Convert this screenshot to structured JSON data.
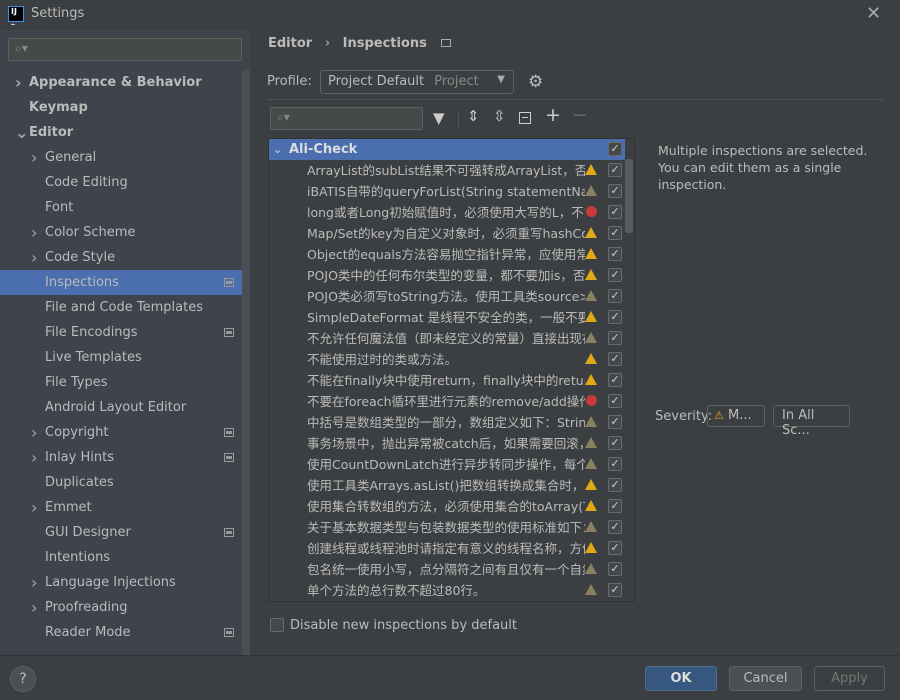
{
  "window": {
    "title": "Settings",
    "logo": "IJ"
  },
  "sidebar": {
    "search_placeholder": "",
    "items": [
      {
        "label": "Appearance & Behavior",
        "bold": true,
        "arrow": ">",
        "level": 0
      },
      {
        "label": "Keymap",
        "bold": true,
        "level": 0
      },
      {
        "label": "Editor",
        "bold": true,
        "arrow": "v",
        "level": 0
      },
      {
        "label": "General",
        "arrow": ">",
        "level": 1
      },
      {
        "label": "Code Editing",
        "level": 1
      },
      {
        "label": "Font",
        "level": 1
      },
      {
        "label": "Color Scheme",
        "arrow": ">",
        "level": 1
      },
      {
        "label": "Code Style",
        "arrow": ">",
        "level": 1
      },
      {
        "label": "Inspections",
        "level": 1,
        "selected": true,
        "project_icon": true
      },
      {
        "label": "File and Code Templates",
        "level": 1
      },
      {
        "label": "File Encodings",
        "level": 1,
        "project_icon": true
      },
      {
        "label": "Live Templates",
        "level": 1
      },
      {
        "label": "File Types",
        "level": 1
      },
      {
        "label": "Android Layout Editor",
        "level": 1
      },
      {
        "label": "Copyright",
        "arrow": ">",
        "level": 1,
        "project_icon": true
      },
      {
        "label": "Inlay Hints",
        "arrow": ">",
        "level": 1,
        "project_icon": true
      },
      {
        "label": "Duplicates",
        "level": 1
      },
      {
        "label": "Emmet",
        "arrow": ">",
        "level": 1
      },
      {
        "label": "GUI Designer",
        "level": 1,
        "project_icon": true
      },
      {
        "label": "Intentions",
        "level": 1
      },
      {
        "label": "Language Injections",
        "arrow": ">",
        "level": 1
      },
      {
        "label": "Proofreading",
        "arrow": ">",
        "level": 1
      },
      {
        "label": "Reader Mode",
        "level": 1,
        "project_icon": true
      }
    ]
  },
  "breadcrumb": {
    "parent": "Editor",
    "sep": "›",
    "current": "Inspections"
  },
  "profile": {
    "label": "Profile:",
    "value": "Project Default",
    "scope": "Project"
  },
  "tree": {
    "group": "Ali-Check",
    "rows": [
      {
        "text": "ArrayList的subList结果不可强转成ArrayList，否则",
        "sev": "warn"
      },
      {
        "text": "iBATIS自带的queryForList(String statementName",
        "sev": "weak"
      },
      {
        "text": "long或者Long初始赋值时，必须使用大写的L，不能",
        "sev": "error"
      },
      {
        "text": "Map/Set的key为自定义对象时，必须重写hashCode",
        "sev": "warn"
      },
      {
        "text": "Object的equals方法容易抛空指针异常，应使用常量",
        "sev": "warn"
      },
      {
        "text": "POJO类中的任何布尔类型的变量，都不要加is，否则",
        "sev": "warn"
      },
      {
        "text": "POJO类必须写toString方法。使用工具类source>",
        "sev": "weak"
      },
      {
        "text": "SimpleDateFormat 是线程不安全的类，一般不要定",
        "sev": "warn"
      },
      {
        "text": "不允许任何魔法值（即未经定义的常量）直接出现在",
        "sev": "weak"
      },
      {
        "text": "不能使用过时的类或方法。",
        "sev": "warn"
      },
      {
        "text": "不能在finally块中使用return，finally块中的return返",
        "sev": "warn"
      },
      {
        "text": "不要在foreach循环里进行元素的remove/add操作",
        "sev": "error"
      },
      {
        "text": "中括号是数组类型的一部分，数组定义如下：String",
        "sev": "weak"
      },
      {
        "text": "事务场景中，抛出异常被catch后，如果需要回滚，一",
        "sev": "weak"
      },
      {
        "text": "使用CountDownLatch进行异步转同步操作，每个线",
        "sev": "weak"
      },
      {
        "text": "使用工具类Arrays.asList()把数组转换成集合时，不能",
        "sev": "warn"
      },
      {
        "text": "使用集合转数组的方法，必须使用集合的toArray(T[]",
        "sev": "warn"
      },
      {
        "text": "关于基本数据类型与包装数据类型的使用标准如下：",
        "sev": "weak"
      },
      {
        "text": "创建线程或线程池时请指定有意义的线程名称，方便",
        "sev": "warn"
      },
      {
        "text": "包名统一使用小写，点分隔符之间有且仅有一个自然",
        "sev": "weak"
      },
      {
        "text": "单个方法的总行数不超过80行。",
        "sev": "weak"
      }
    ]
  },
  "info": {
    "line1": "Multiple inspections are selected.",
    "line2": "You can edit them as a single",
    "line3": "inspection."
  },
  "severity": {
    "label": "Severity:",
    "value": "M...",
    "scope": "In All Sc..."
  },
  "disable_new": {
    "label": "Disable new inspections by default",
    "checked": false
  },
  "buttons": {
    "ok": "OK",
    "cancel": "Cancel",
    "apply": "Apply",
    "help": "?"
  },
  "colors": {
    "selection": "#4b6eaf",
    "warning": "#e2a917",
    "error": "#c93b3b",
    "ok_button": "#365880"
  }
}
